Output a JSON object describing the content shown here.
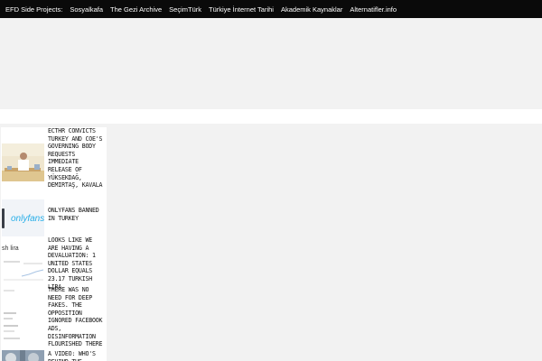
{
  "topbar": {
    "prefix": "EFD Side Projects:",
    "links": [
      "Sosyalkafa",
      "The Gezi Archive",
      "SeçimTürk",
      "Türkiye İnternet Tarihi",
      "Akademik Kaynaklar",
      "Alternatifler.info"
    ]
  },
  "posts": [
    {
      "title": "ECTHR CONVICTS TURKEY AND COE'S GOVERNING BODY REQUESTS IMMEDIATE RELEASE OF YÜKSEKDAĞ, DEMIRTAŞ, KAVALA"
    },
    {
      "title": "ONLYFANS BANNED IN TURKEY",
      "thumb_text": "onlyfans"
    },
    {
      "title": "LOOKS LIKE WE ARE HAVING A DEVALUATION: 1 UNITED STATES DOLLAR EQUALS 23.17 TURKISH LIRA",
      "thumb_text": "sh lira"
    },
    {
      "title": "THERE WAS NO NEED FOR DEEP FAKES. THE OPPOSITION IGNORED FACEBOOK ADS, DISINFORMATION FLOURISHED THERE"
    },
    {
      "title": "A VIDEO: WHO'S BEHIND THE"
    }
  ],
  "colors": {
    "topbar": "#0a0a0a",
    "page_bg": "#f2f2f2",
    "sidebar_bg": "#ffffff"
  }
}
